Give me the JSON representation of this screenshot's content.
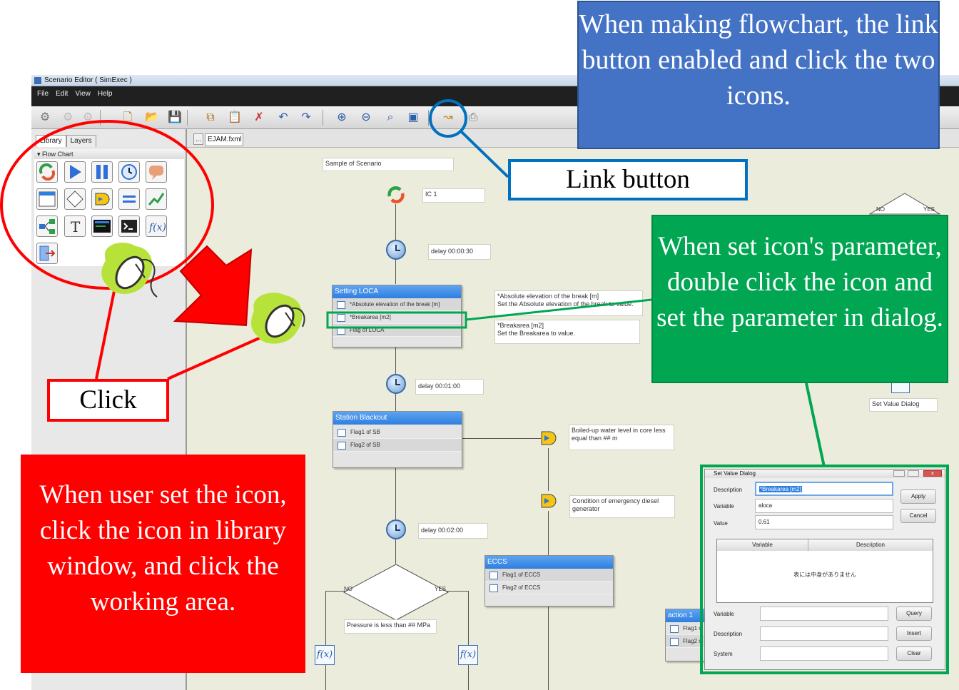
{
  "window": {
    "title": "Scenario Editor ( SimExec )",
    "menu": [
      "File",
      "Edit",
      "View",
      "Help"
    ]
  },
  "library": {
    "tabs": [
      "Library",
      "Layers"
    ],
    "section": "Flow Chart"
  },
  "document": {
    "tab_dots": "...",
    "tab_name": "EJAM.fxml"
  },
  "flowchart": {
    "title_note": "Sample of Scenario",
    "ic_label": "IC 1",
    "delay1": "delay  00:00:30",
    "block1": {
      "title": "Setting LOCA",
      "rows": [
        "*Absolute elevation of the break [m]",
        "*Breakarea [m2]",
        "Flag of LOCA"
      ]
    },
    "note_abs": "*Absolute elevation of the break [m]\nSet the Absolute elevation of the break to value.",
    "note_break": "*Breakarea [m2]\nSet the Breakarea to value.",
    "delay2": "delay  00:01:00",
    "block2": {
      "title": "Station Blackout",
      "rows": [
        "Flag1 of SB",
        "Flag2 of SB"
      ]
    },
    "cond1": "Boiled-up water level in core less equal than ## m",
    "cond2": "Condition of emergency diesel generator",
    "delay3": "delay  00:02:00",
    "decision": {
      "no": "NO",
      "yes": "YES",
      "text": "Pressure is less than ## MPa"
    },
    "block3": {
      "title": "ECCS",
      "rows": [
        "Flag1 of ECCS",
        "Flag2 of ECCS"
      ]
    },
    "block4": {
      "title": "action 1",
      "rows": [
        "Flag1 o",
        "Flag2 o"
      ]
    },
    "right_decision": {
      "no": "NO",
      "yes": "YES"
    },
    "set_value_label": "Set Value Dialog",
    "func_symbol": "f(x)"
  },
  "dialog": {
    "title": "Set Value Dialog",
    "description_label": "Description",
    "description_value": "*Breakarea [m2]",
    "variable_label": "Variable",
    "variable_value": "aloca",
    "value_label": "Value",
    "value_value": "0.61",
    "apply": "Apply",
    "cancel": "Cancel",
    "table_headers": [
      "Variable",
      "Description"
    ],
    "table_empty": "表には中身がありません",
    "search_variable_label": "Variable",
    "search_description_label": "Description",
    "search_system_label": "System",
    "query": "Query",
    "insert": "Insert",
    "clear": "Clear"
  },
  "annotations": {
    "blue": "When making flowchart, the link button enabled and click the two icons.",
    "link_button": "Link button",
    "green": "When set icon's parameter,  double click the icon and set the parameter in dialog.",
    "click": "Click",
    "red": "When user set the icon, click the icon in library window, and click the working area."
  },
  "colors": {
    "callout_blue": "#4472c4",
    "callout_green": "#00a651",
    "callout_red": "#ff0000",
    "block_header": "#3d8ae8",
    "workarea": "#ececdc"
  },
  "icons": [
    "settings-gear-icon",
    "new-document-icon",
    "open-folder-icon",
    "save-icon",
    "copy-icon",
    "paste-icon",
    "delete-icon",
    "undo-icon",
    "redo-icon",
    "zoom-in-icon",
    "zoom-out-icon",
    "zoom-fit-icon",
    "select-area-icon",
    "link-icon",
    "print-icon",
    "mouse-icon"
  ]
}
